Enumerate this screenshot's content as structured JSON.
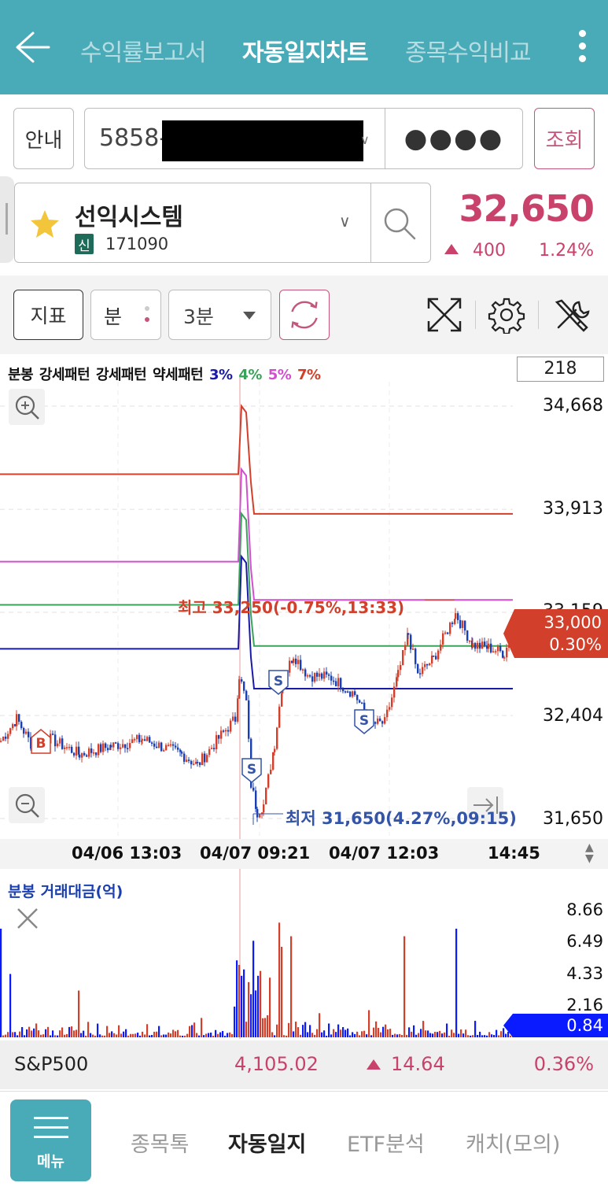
{
  "header": {
    "tabs": [
      {
        "label": "수익률보고서"
      },
      {
        "label": "자동일지차트"
      },
      {
        "label": "종목수익비교"
      }
    ]
  },
  "account": {
    "guide_label": "안내",
    "number_prefix": "5858-",
    "password_mask": "●●●●",
    "query_label": "조회"
  },
  "stock": {
    "name": "선익시스템",
    "badge": "신",
    "code": "171090",
    "price": "32,650",
    "change": "400",
    "change_pct": "1.24%"
  },
  "toolbar": {
    "indicator_label": "지표",
    "unit_label": "분",
    "interval_label": "3분"
  },
  "chart": {
    "legend": [
      {
        "text": "분봉",
        "color": "#111111"
      },
      {
        "text": "강세패턴",
        "color": "#111111"
      },
      {
        "text": "강세패턴",
        "color": "#111111"
      },
      {
        "text": "약세패턴",
        "color": "#111111"
      },
      {
        "text": "3%",
        "color": "#1a1aa8"
      },
      {
        "text": "4%",
        "color": "#3aa35a"
      },
      {
        "text": "5%",
        "color": "#d24fd0"
      },
      {
        "text": "7%",
        "color": "#d23f2a"
      }
    ],
    "candle_count": "218",
    "current_price": "33,000",
    "current_pct": "0.30%",
    "high_label": "최고 33,250(-0.75%,13:33)",
    "low_label": "최저 31,650(4.27%,09:15)",
    "x_labels": [
      "04/06 13:03",
      "04/07 09:21",
      "04/07 12:03",
      "14:45"
    ],
    "volume_title": "분봉 거래대금(억)",
    "volume_current": "0.84",
    "markers": [
      "B",
      "S",
      "S",
      "S"
    ]
  },
  "chart_data": {
    "type": "line",
    "title": "",
    "y_ticks": [
      "34,668",
      "33,913",
      "33,159",
      "32,404",
      "31,650"
    ],
    "ylim": [
      31650,
      34668
    ],
    "x_ticks": [
      "04/06 13:03",
      "04/07 09:21",
      "04/07 12:03",
      "14:45"
    ],
    "high": {
      "price": 33250,
      "change_pct": -0.75,
      "time": "13:33"
    },
    "low": {
      "price": 31650,
      "change_pct": 4.27,
      "time": "09:15"
    },
    "current": {
      "price": 33000,
      "change_pct": 0.3
    },
    "series": [
      {
        "name": "3%",
        "color": "#1a1aa8",
        "before": 32892,
        "peak": 33567,
        "after": 32600
      },
      {
        "name": "4%",
        "color": "#3aa35a",
        "before": 33214,
        "peak": 33881,
        "after": 32913
      },
      {
        "name": "5%",
        "color": "#d24fd0",
        "before": 33530,
        "peak": 34205,
        "after": 33250
      },
      {
        "name": "7%",
        "color": "#d23f2a",
        "before": 34170,
        "peak": 34668,
        "after": 33880
      }
    ],
    "volume": {
      "title": "분봉 거래대금(억)",
      "y_ticks": [
        "8.66",
        "6.49",
        "4.33",
        "2.16"
      ],
      "ylim": [
        0,
        8.66
      ],
      "current": 0.84
    }
  },
  "index_bar": {
    "name": "S&P500",
    "value": "4,105.02",
    "change": "14.64",
    "change_pct": "0.36%"
  },
  "bottom_nav": {
    "menu_label": "메뉴",
    "items": [
      {
        "label": "종목톡"
      },
      {
        "label": "자동일지"
      },
      {
        "label": "ETF분석"
      },
      {
        "label": "캐치(모의)"
      }
    ]
  },
  "colors": {
    "header_bg": "#4aabb8",
    "up_red": "#c9426b",
    "candle_red": "#d23f2a",
    "candle_blue": "#1a3fb0"
  }
}
